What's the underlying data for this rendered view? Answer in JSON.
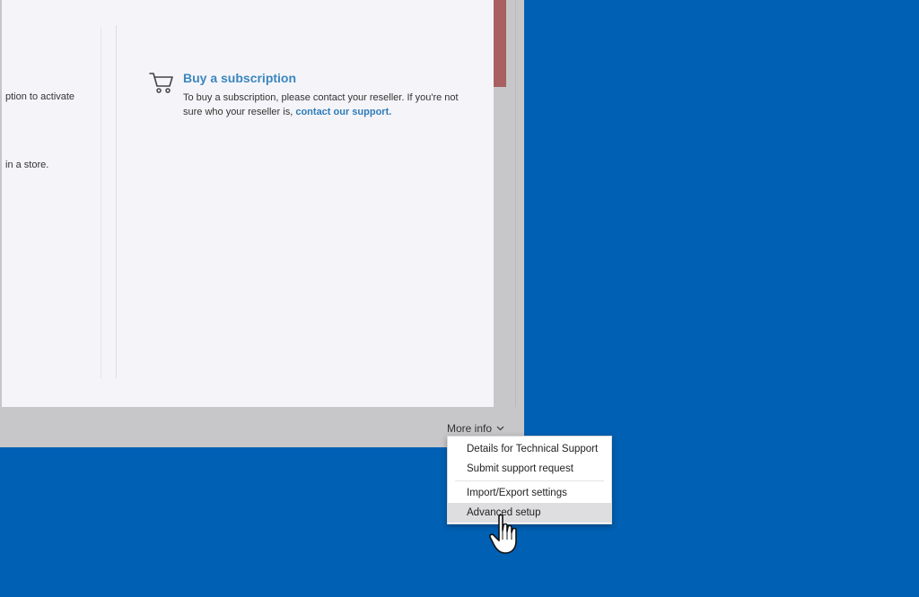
{
  "left_panel": {
    "line1": "ption to activate",
    "line2": "in a store."
  },
  "subscription": {
    "title": "Buy a subscription",
    "description": "To buy a subscription, please contact your reseller. If you're not sure who your reseller is,",
    "support_link": "contact our support."
  },
  "more_info": {
    "label": "More info"
  },
  "menu": {
    "items": [
      {
        "label": "Details for Technical Support"
      },
      {
        "label": "Submit support request"
      },
      {
        "label": "Import/Export settings"
      },
      {
        "label": "Advanced setup"
      }
    ]
  },
  "colors": {
    "desktop": "#0060b3",
    "link": "#3a86bf",
    "hover": "#dedde0"
  },
  "icons": {
    "cart": "shopping-cart-icon",
    "chevron": "chevron-down-icon",
    "cursor": "hand-pointer-icon"
  }
}
